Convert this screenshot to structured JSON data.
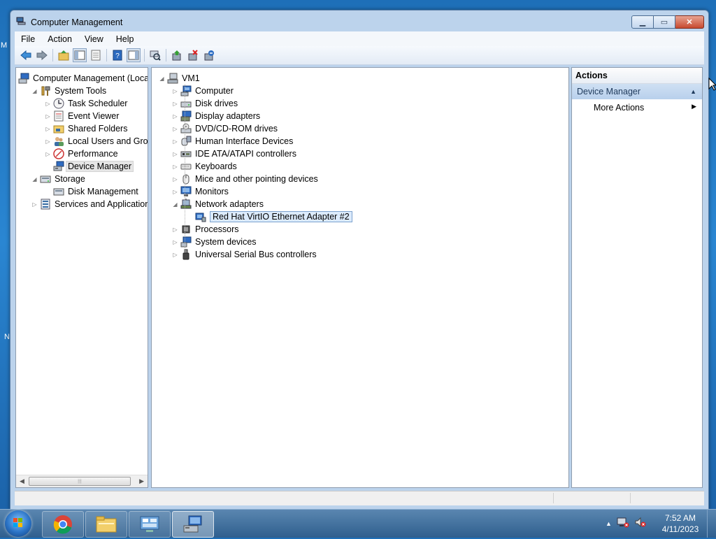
{
  "window": {
    "title": "Computer Management"
  },
  "menu": [
    "File",
    "Action",
    "View",
    "Help"
  ],
  "toolbar_icons": [
    "back-arrow-icon",
    "forward-arrow-icon",
    "up-folder-icon",
    "show-hide-tree-icon",
    "properties-icon",
    "help-icon",
    "show-hide-action-icon",
    "scan-hardware-icon",
    "update-driver-icon",
    "uninstall-device-icon",
    "disable-device-icon"
  ],
  "left_tree": [
    {
      "label": "Computer Management (Local",
      "icon": "computer-management-icon",
      "expander": "",
      "level": 0
    },
    {
      "label": "System Tools",
      "icon": "system-tools-icon",
      "expander": "expanded",
      "level": 1
    },
    {
      "label": "Task Scheduler",
      "icon": "task-scheduler-icon",
      "expander": "collapsed",
      "level": 2
    },
    {
      "label": "Event Viewer",
      "icon": "event-viewer-icon",
      "expander": "collapsed",
      "level": 2
    },
    {
      "label": "Shared Folders",
      "icon": "shared-folders-icon",
      "expander": "collapsed",
      "level": 2
    },
    {
      "label": "Local Users and Groups",
      "icon": "local-users-icon",
      "expander": "collapsed",
      "level": 2
    },
    {
      "label": "Performance",
      "icon": "performance-icon",
      "expander": "collapsed",
      "level": 2
    },
    {
      "label": "Device Manager",
      "icon": "device-manager-icon",
      "expander": "",
      "level": 2,
      "selected": true
    },
    {
      "label": "Storage",
      "icon": "storage-icon",
      "expander": "expanded",
      "level": 1
    },
    {
      "label": "Disk Management",
      "icon": "disk-management-icon",
      "expander": "",
      "level": 2
    },
    {
      "label": "Services and Applications",
      "icon": "services-icon",
      "expander": "collapsed",
      "level": 1
    }
  ],
  "device_tree": {
    "root": "VM1",
    "categories": [
      {
        "label": "Computer",
        "icon": "computer-icon",
        "expander": "collapsed"
      },
      {
        "label": "Disk drives",
        "icon": "disk-drive-icon",
        "expander": "collapsed"
      },
      {
        "label": "Display adapters",
        "icon": "display-adapter-icon",
        "expander": "collapsed"
      },
      {
        "label": "DVD/CD-ROM drives",
        "icon": "dvd-drive-icon",
        "expander": "collapsed"
      },
      {
        "label": "Human Interface Devices",
        "icon": "hid-icon",
        "expander": "collapsed"
      },
      {
        "label": "IDE ATA/ATAPI controllers",
        "icon": "ide-controller-icon",
        "expander": "collapsed"
      },
      {
        "label": "Keyboards",
        "icon": "keyboard-icon",
        "expander": "collapsed"
      },
      {
        "label": "Mice and other pointing devices",
        "icon": "mouse-icon",
        "expander": "collapsed"
      },
      {
        "label": "Monitors",
        "icon": "monitor-icon",
        "expander": "collapsed"
      },
      {
        "label": "Network adapters",
        "icon": "network-adapter-icon",
        "expander": "expanded",
        "children": [
          {
            "label": "Red Hat VirtIO Ethernet Adapter #2",
            "icon": "ethernet-adapter-icon",
            "selected": true
          }
        ]
      },
      {
        "label": "Processors",
        "icon": "processor-icon",
        "expander": "collapsed"
      },
      {
        "label": "System devices",
        "icon": "system-devices-icon",
        "expander": "collapsed"
      },
      {
        "label": "Universal Serial Bus controllers",
        "icon": "usb-icon",
        "expander": "collapsed"
      }
    ]
  },
  "actions": {
    "header": "Actions",
    "section": "Device Manager",
    "items": [
      "More Actions"
    ]
  },
  "taskbar": {
    "apps": [
      {
        "name": "chrome",
        "icon": "chrome-icon"
      },
      {
        "name": "explorer",
        "icon": "file-explorer-icon"
      },
      {
        "name": "control-panel",
        "icon": "control-panel-icon"
      },
      {
        "name": "computer-management",
        "icon": "computer-management-icon",
        "active": true
      }
    ],
    "time": "7:52 AM",
    "date": "4/11/2023"
  },
  "colors": {
    "selection_blue": "#dcebfc",
    "title_blue": "#bcd3ec",
    "close_red": "#c74a2f"
  }
}
